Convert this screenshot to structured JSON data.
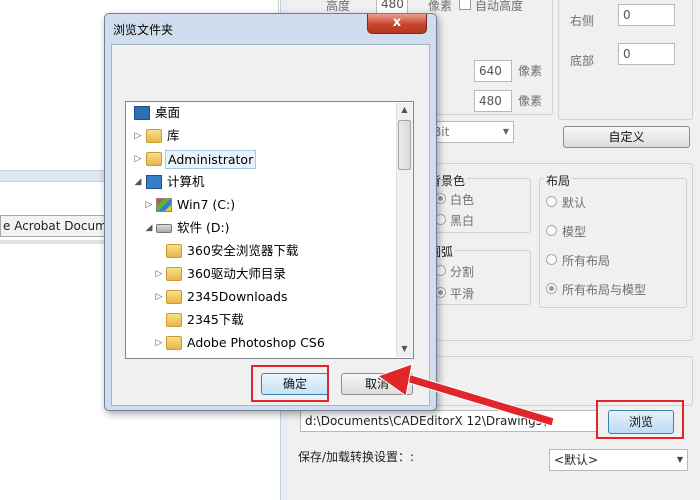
{
  "background_left": {
    "acrobat_item": "e Acrobat Documen"
  },
  "right_panel": {
    "height_label": "高度",
    "height_value": "480",
    "pixel_label_1": "像素",
    "auto_height_label": "自动高度",
    "right_label": "右侧",
    "right_value": "0",
    "bottom_label": "底部",
    "bottom_value": "0",
    "width2_value": "640",
    "pixel_label_2": "像素",
    "height2_value": "480",
    "pixel_label_3": "像素",
    "bit_value": "Bit",
    "custom_button": "自定义",
    "bg_color_title": "背景色",
    "bg_white": "白色",
    "bg_black": "黑白",
    "layout_title": "布局",
    "layout_default": "默认",
    "layout_model": "模型",
    "layout_all": "所有布局",
    "layout_all_model": "所有布局与模型",
    "arc_title": "圆弧",
    "arc_split": "分割",
    "arc_smooth": "平滑",
    "path_value": "d:\\Documents\\CADEditorX 12\\Drawings\\",
    "browse_button": "浏览",
    "save_load_label": "保存/加载转换设置：:",
    "save_load_select": "<默认>"
  },
  "dialog": {
    "title": "浏览文件夹",
    "close_symbol": "x",
    "ok_button": "确定",
    "cancel_button": "取消",
    "tree": [
      {
        "label": "桌面",
        "icon": "desktop-icon"
      },
      {
        "label": "库",
        "icon": "library-icon"
      },
      {
        "label": "Administrator",
        "icon": "user-folder-icon"
      },
      {
        "label": "计算机",
        "icon": "computer-icon"
      },
      {
        "label": "Win7 (C:)",
        "icon": "windows-drive-icon"
      },
      {
        "label": "软件 (D:)",
        "icon": "drive-icon"
      },
      {
        "label": "360安全浏览器下载",
        "icon": "folder-icon"
      },
      {
        "label": "360驱动大师目录",
        "icon": "folder-icon"
      },
      {
        "label": "2345Downloads",
        "icon": "folder-icon"
      },
      {
        "label": "2345下载",
        "icon": "folder-icon"
      },
      {
        "label": "Adobe Photoshop CS6",
        "icon": "folder-icon"
      }
    ]
  },
  "colors": {
    "annotation_red": "#e0262b",
    "dialog_frame": "#cfddee",
    "close_button": "#c6462d"
  }
}
